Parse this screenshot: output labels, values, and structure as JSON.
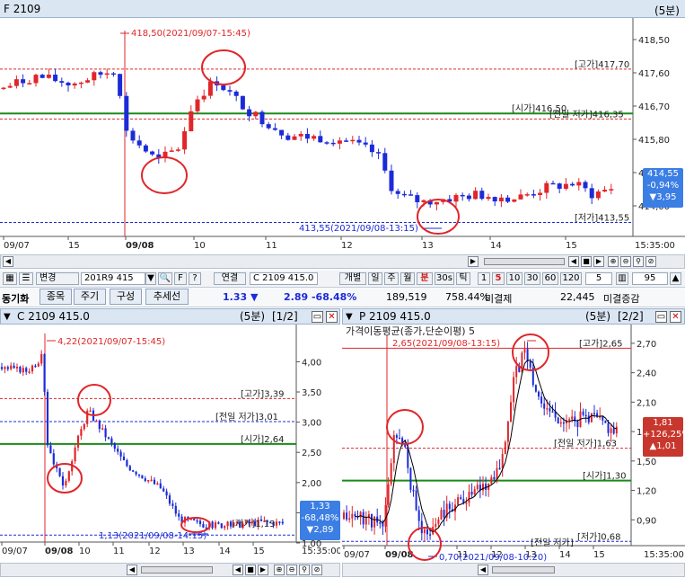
{
  "top": {
    "title": "F 2109",
    "period": "(5분)",
    "y_ticks": [
      "418,50",
      "417,60",
      "416,70",
      "415,80",
      "414,90",
      "414,00"
    ],
    "x_ticks": [
      "09/07",
      "15",
      "09/08",
      "10",
      "11",
      "12",
      "13",
      "14",
      "15",
      "15:35:00"
    ],
    "ann_high": "418,50(2021/09/07-15:45)",
    "ann_low": "413,55(2021/09/08-13:15)",
    "lbl_high": "[고가]417,70",
    "lbl_open": "[시가]416,50",
    "lbl_prevlow": "[전일 저가]416,35",
    "lbl_low": "[저가]413,55",
    "price": {
      "value": "414,55",
      "pct": "-0,94%",
      "chg": "▼3,95"
    }
  },
  "toolbar": {
    "item_select": "변경",
    "code": "201R9 415",
    "link": "연결",
    "code2": "C 2109 415.0",
    "periods": [
      "개별",
      "일",
      "주",
      "월",
      "분",
      "30s",
      "틱"
    ],
    "intervals": [
      "1",
      "5",
      "10",
      "30",
      "60",
      "120"
    ],
    "count": "5",
    "count2": "95"
  },
  "tabs": {
    "label": "동기화",
    "items": [
      "종목",
      "주기",
      "구성",
      "추세선"
    ],
    "price": "1.33 ▼",
    "change": "2.89 -68.48%",
    "volume": "189,519",
    "ratio": "758.44%",
    "unsettled_label": "미결제",
    "unsettled": "22,445",
    "unsettled_chg": "미결증감"
  },
  "left": {
    "title": "C 2109 415.0",
    "period": "(5분)",
    "page": "[1/2]",
    "y_ticks": [
      "4,00",
      "3,50",
      "3,00",
      "2,50",
      "2,00",
      "1,50",
      "1,00"
    ],
    "x_ticks": [
      "09/07",
      "09/08",
      "10",
      "11",
      "12",
      "13",
      "14",
      "15",
      "15:35:00"
    ],
    "ann_high": "4,22(2021/09/07-15:45)",
    "ann_low": "1,13(2021/09/08-14:15)",
    "lbl_high": "[고가]3,39",
    "lbl_prevlow": "[전일 저가]3,01",
    "lbl_open": "[시가]2,64",
    "lbl_low": "[저가]1,13",
    "price": {
      "value": "1,33",
      "pct": "-68,48%",
      "chg": "▼2,89"
    }
  },
  "right": {
    "title": "P 2109 415.0",
    "period": "(5분)",
    "page": "[2/2]",
    "subtitle": "가격이동평균(종가,단순이평) 5",
    "y_ticks": [
      "2,70",
      "2,40",
      "2,10",
      "1,80",
      "1,50",
      "1,20",
      "0,90"
    ],
    "x_ticks": [
      "09/07",
      "09/08",
      "11",
      "12",
      "13",
      "14",
      "15",
      "15:35:00"
    ],
    "ann_high": "2,65(2021/09/08-13:15)",
    "ann_low": "0,70(2021/09/08-10:20)",
    "lbl_high": "[고가]2,65",
    "lbl_prevlow": "[전일 저가]1,63",
    "lbl_open": "[시가]1,30",
    "lbl_low": "[저가]0,68",
    "lbl_prevlow2": "[전일 저가]",
    "price": {
      "value": "1,81",
      "pct": "+126,25%",
      "chg": "▲1,01"
    }
  },
  "colors": {
    "up": "#e0262a",
    "down": "#1c2bd8",
    "green": "#1a8a1a",
    "circle": "#e0262a",
    "ma": "#000000"
  }
}
